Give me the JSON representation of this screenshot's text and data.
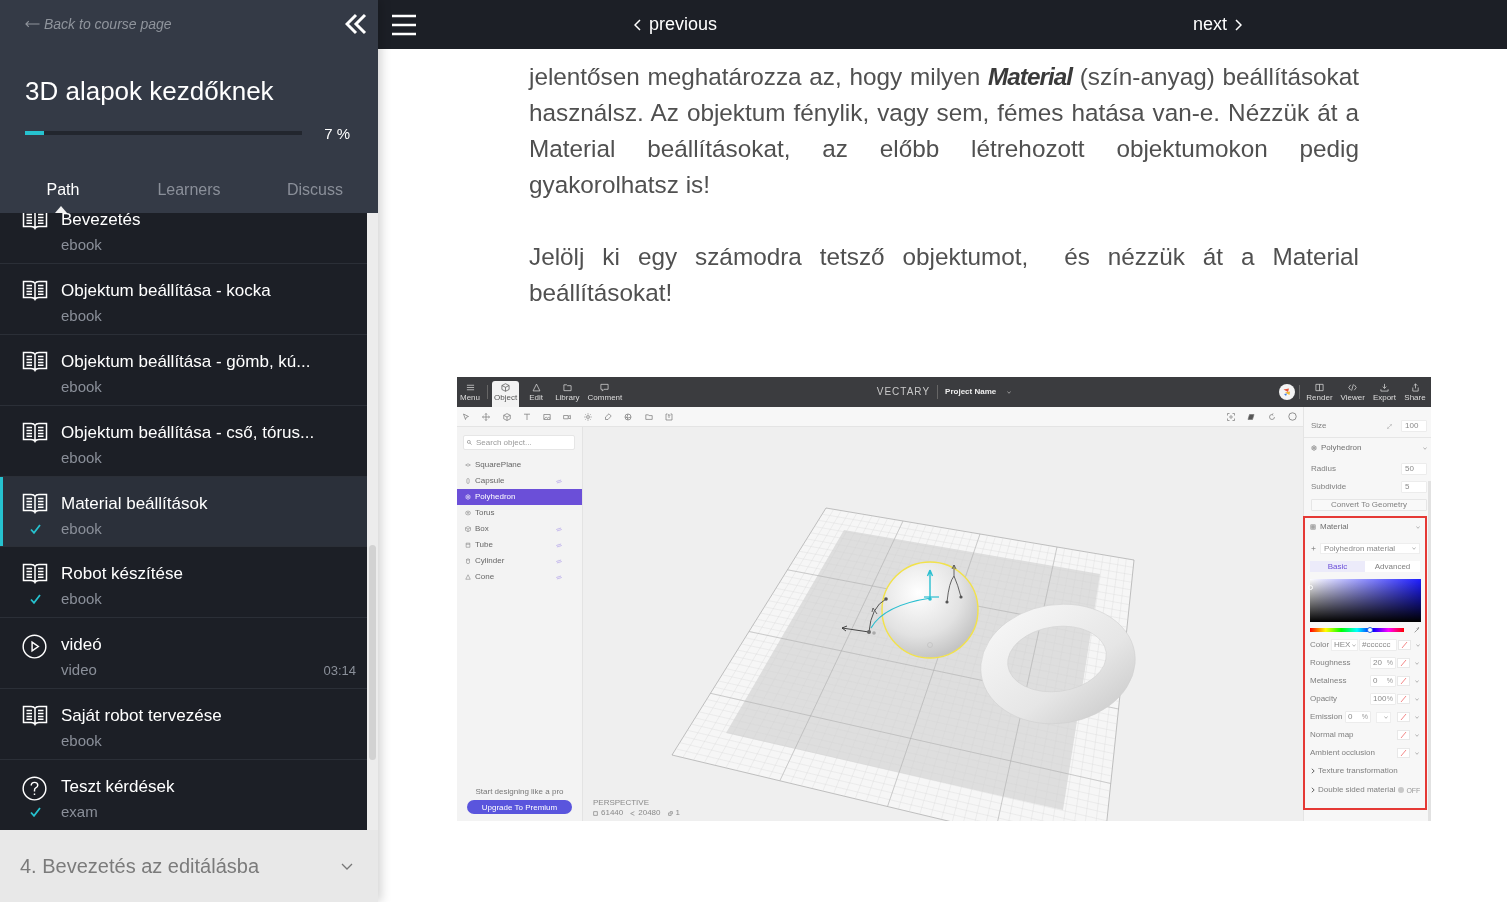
{
  "sidebar": {
    "back_link": "Back to course page",
    "course_title": "3D alapok kezdőknek",
    "progress": {
      "level": 0.07,
      "label": "7 %"
    },
    "tabs": [
      {
        "label": "Path",
        "selected": true
      },
      {
        "label": "Learners",
        "selected": false
      },
      {
        "label": "Discuss",
        "selected": false
      }
    ],
    "lessons": [
      {
        "kind": "ebook",
        "title": "Bevezetés",
        "type": "ebook",
        "done": false,
        "selected": false
      },
      {
        "kind": "ebook",
        "title": "Objektum beállítása - kocka",
        "type": "ebook",
        "done": false,
        "selected": false
      },
      {
        "kind": "ebook",
        "title": "Objektum beállítása - gömb, kú...",
        "type": "ebook",
        "done": false,
        "selected": false
      },
      {
        "kind": "ebook",
        "title": "Objektum beállítása - cső, tórus...",
        "type": "ebook",
        "done": false,
        "selected": false
      },
      {
        "kind": "ebook",
        "title": "Material beállítások",
        "type": "ebook",
        "done": true,
        "selected": true
      },
      {
        "kind": "ebook",
        "title": "Robot készítése",
        "type": "ebook",
        "done": true,
        "selected": false
      },
      {
        "kind": "video",
        "title": "videó",
        "type": "video",
        "duration": "03:14",
        "done": false,
        "selected": false
      },
      {
        "kind": "ebook",
        "title": "Saját robot tervezése",
        "type": "ebook",
        "done": false,
        "selected": false
      },
      {
        "kind": "exam",
        "title": "Teszt kérdések",
        "type": "exam",
        "done": true,
        "selected": false
      }
    ],
    "next_section": {
      "title": "4. Bevezetés az editálásba",
      "expanded": false
    }
  },
  "topbar": {
    "previous": "previous",
    "next": "next"
  },
  "content": {
    "paragraphs": [
      "jelentősen meghatározza az, hogy milyen *Material* (szín-anyag) beállításokat használsz. Az objektum fénylik, vagy sem, fémes hatása van-e. Nézzük át a Material beállításokat, az előbb létrehozott objektumokon pedig gyakorolhatsz is!",
      "Jelölj ki egy számodra tetsző objektumot,  és nézzük át a Material beállításokat!"
    ],
    "app_screenshot": {
      "menu": "Menu",
      "tabs": [
        {
          "kind": "object",
          "label": "Object",
          "selected": true
        },
        {
          "kind": "edit",
          "label": "Edit",
          "selected": false
        },
        {
          "kind": "library",
          "label": "Library",
          "selected": false
        },
        {
          "kind": "comment",
          "label": "Comment",
          "selected": false
        }
      ],
      "logo": "VECTARY",
      "project_name": "Project Name",
      "actions": [
        {
          "kind": "render",
          "label": "Render"
        },
        {
          "kind": "viewer",
          "label": "Viewer"
        },
        {
          "kind": "export",
          "label": "Export"
        },
        {
          "kind": "share",
          "label": "Share"
        }
      ],
      "search": {
        "placeholder": "Search object..."
      },
      "objects": [
        {
          "kind": "plane",
          "name": "SquarePlane",
          "selected": false,
          "hidden": false
        },
        {
          "kind": "capsule",
          "name": "Capsule",
          "selected": false,
          "hidden": true
        },
        {
          "kind": "polyhedron",
          "name": "Polyhedron",
          "selected": true,
          "hidden": false
        },
        {
          "kind": "torus",
          "name": "Torus",
          "selected": false,
          "hidden": false
        },
        {
          "kind": "box",
          "name": "Box",
          "selected": false,
          "hidden": true
        },
        {
          "kind": "tube",
          "name": "Tube",
          "selected": false,
          "hidden": true
        },
        {
          "kind": "cylinder",
          "name": "Cylinder",
          "selected": false,
          "hidden": true
        },
        {
          "kind": "cone",
          "name": "Cone",
          "selected": false,
          "hidden": true
        }
      ],
      "promo": "Start designing like a pro",
      "upgrade_button": "Upgrade To Premium",
      "view_label": "PERSPECTIVE",
      "stats": [
        "61440",
        "20480",
        "1"
      ],
      "properties": {
        "size": {
          "label": "Size",
          "value": "100"
        },
        "shape": "Polyhedron",
        "fields": [
          {
            "label": "Radius",
            "value": "50"
          },
          {
            "label": "Subdivide",
            "value": "5"
          }
        ],
        "convert_button": "Convert To Geometry",
        "material": {
          "title": "Material",
          "preset": "Polyhedron material",
          "tabs": [
            {
              "label": "Basic",
              "selected": true
            },
            {
              "label": "Advanced",
              "selected": false
            }
          ],
          "hue_slider": {
            "level": 0.64
          },
          "color": {
            "label": "Color",
            "format": "HEX",
            "value": "#cccccc"
          },
          "rows": [
            {
              "kind": "percent",
              "label": "Roughness",
              "value": "20",
              "unit": "%"
            },
            {
              "kind": "percent",
              "label": "Metalness",
              "value": "0",
              "unit": "%"
            },
            {
              "kind": "percent",
              "label": "Opacity",
              "value": "100",
              "unit": "%"
            },
            {
              "kind": "emission",
              "label": "Emission",
              "value": "0",
              "unit": "%"
            },
            {
              "kind": "map",
              "label": "Normal map"
            },
            {
              "kind": "map",
              "label": "Ambient occlusion"
            }
          ],
          "sections": [
            {
              "label": "Texture transformation"
            },
            {
              "label": "Double sided material",
              "toggle": {
                "on": false,
                "label": "OFF"
              }
            }
          ]
        }
      }
    }
  }
}
